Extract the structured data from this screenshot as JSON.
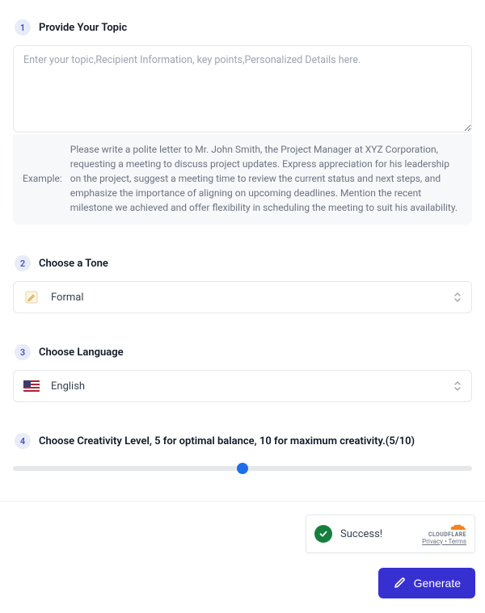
{
  "steps": {
    "s1": {
      "num": "1",
      "title": "Provide Your Topic"
    },
    "s2": {
      "num": "2",
      "title": "Choose a Tone"
    },
    "s3": {
      "num": "3",
      "title": "Choose Language"
    },
    "s4": {
      "num": "4",
      "title": "Choose Creativity Level, 5 for optimal balance, 10 for maximum creativity.(5/10)"
    }
  },
  "topic": {
    "placeholder": "Enter your topic,Recipient Information, key points,Personalized Details here.",
    "value": "",
    "example_label": "Example:",
    "example_text": "Please write a polite letter to Mr. John Smith, the Project Manager at XYZ Corporation, requesting a meeting to discuss project updates. Express appreciation for his leadership on the project, suggest a meeting time to review the current status and next steps, and emphasize the importance of aligning on upcoming deadlines. Mention the recent milestone we achieved and offer flexibility in scheduling the meeting to suit his availability."
  },
  "tone": {
    "selected": "Formal"
  },
  "language": {
    "selected": "English"
  },
  "creativity": {
    "value": 5,
    "min": 0,
    "max": 10
  },
  "captcha": {
    "status": "Success!",
    "brand": "CLOUDFLARE",
    "privacy": "Privacy",
    "terms": "Terms",
    "sep": " • "
  },
  "actions": {
    "generate_label": "Generate"
  }
}
